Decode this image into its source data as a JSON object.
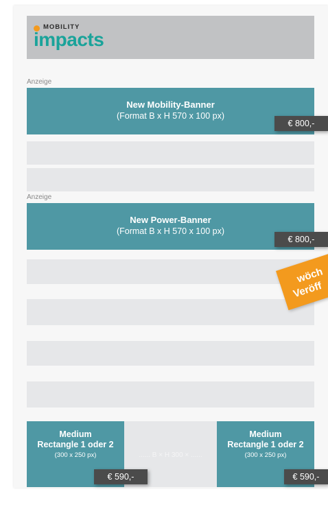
{
  "logo": {
    "small": "MOBILITY",
    "big": "impacts"
  },
  "ads": [
    {
      "label": "Anzeige",
      "title": "New Mobility-Banner",
      "format": "(Format B x H 570 x 100 px)",
      "price": "€ 800,-"
    },
    {
      "label": "Anzeige",
      "title": "New Power-Banner",
      "format": "(Format B x H 570 x 100 px)",
      "price": "€ 800,-"
    }
  ],
  "badge": {
    "line1": "wöch",
    "line2": "Veröff"
  },
  "rectangles": [
    {
      "line1": "Medium",
      "line2": "Rectangle 1 oder 2",
      "size": "(300 x 250 px)",
      "price": "€ 590,-"
    },
    {
      "line1": "Medium",
      "line2": "Rectangle 1 oder 2",
      "size": "(300 x 250 px)",
      "price": "€ 590,-"
    }
  ],
  "middle_ghost": "...... B × H 300 × ......",
  "colors": {
    "banner": "#4f98a4",
    "price_tag": "#4b4b4b",
    "badge": "#f39a1e",
    "logo": "#1aa39a",
    "header": "#c1c2c4"
  }
}
